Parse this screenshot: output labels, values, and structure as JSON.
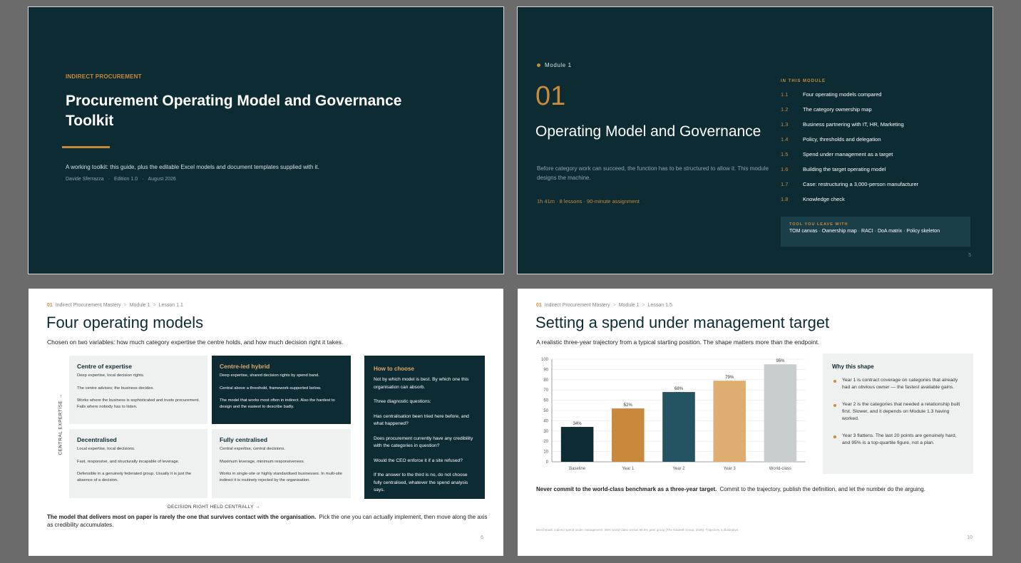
{
  "slide1": {
    "eyebrow": "INDIRECT PROCUREMENT",
    "title": "Procurement Operating Model and Governance Toolkit",
    "subtitle": "A working toolkit: this guide, plus the editable Excel models and document templates supplied with it.",
    "author": "Davide Sferrazza",
    "edition": "Edition 1.0",
    "date": "August 2026"
  },
  "slide2": {
    "module_label": "Module 1",
    "module_number": "01",
    "title": "Operating Model and Governance",
    "description": "Before category work can succeed, the function has to be structured to allow it. This module designs the machine.",
    "stats": "1h 41m · 8 lessons · 90-minute assignment",
    "in_module_label": "IN THIS MODULE",
    "lessons": [
      {
        "num": "1.1",
        "label": "Four operating models compared"
      },
      {
        "num": "1.2",
        "label": "The category ownership map"
      },
      {
        "num": "1.3",
        "label": "Business partnering with IT, HR, Marketing"
      },
      {
        "num": "1.4",
        "label": "Policy, thresholds and delegation"
      },
      {
        "num": "1.5",
        "label": "Spend under management as a target"
      },
      {
        "num": "1.6",
        "label": "Building the target operating model"
      },
      {
        "num": "1.7",
        "label": "Case: restructuring a 3,000-person manufacturer"
      },
      {
        "num": "1.8",
        "label": "Knowledge check"
      }
    ],
    "tool_label": "TOOL YOU LEAVE WITH",
    "tool_text": "TOM canvas · Ownership map · RACI · DoA matrix · Policy skeleton",
    "page": "5"
  },
  "slide3": {
    "crumb": {
      "num": "01",
      "course": "Indirect Procurement Mastery",
      "module": "Module 1",
      "lesson": "Lesson 1.1"
    },
    "title": "Four operating models",
    "lede": "Chosen on two variables: how much category expertise the centre holds, and how much decision right it takes.",
    "quadrants": [
      {
        "title": "Centre of expertise",
        "lines": [
          "Deep expertise, local decision rights.",
          "The centre advises; the business decides.",
          "Works where the business is sophisticated and trusts procurement. Fails where nobody has to listen."
        ]
      },
      {
        "title": "Centre-led hybrid",
        "lines": [
          "Deep expertise, shared decision rights by spend band.",
          "Central above a threshold, framework-supported below.",
          "The model that works most often in indirect. Also the hardest to design and the easiest to describe badly."
        ]
      },
      {
        "title": "Decentralised",
        "lines": [
          "Local expertise, local decisions.",
          "Fast, responsive, and structurally incapable of leverage.",
          "Defensible in a genuinely federated group. Usually it is just the absence of a decision."
        ]
      },
      {
        "title": "Fully centralised",
        "lines": [
          "Central expertise, central decisions.",
          "Maximum leverage, minimum responsiveness.",
          "Works in single-site or highly standardised businesses. In multi-site indirect it is routinely rejected by the organisation."
        ]
      }
    ],
    "y_axis_label": "CENTRAL EXPERTISE →",
    "x_axis_label": "DECISION RIGHT HELD CENTRALLY →",
    "choose": {
      "title": "How to choose",
      "paras": [
        "Not by which model is best. By which one this organisation can absorb.",
        "Three diagnostic questions:",
        "Has centralisation been tried here before, and what happened?",
        "Does procurement currently have any credibility with the categories in question?",
        "Would the CEO enforce it if a site refused?",
        "If the answer to the third is no, do not choose fully centralised, whatever the spend analysis says."
      ]
    },
    "bottom_bold": "The model that delivers most on paper is rarely the one that survives contact with the organisation.",
    "bottom_rest": "Pick the one you can actually implement, then move along the axis as credibility accumulates.",
    "page": "6"
  },
  "slide4": {
    "crumb": {
      "num": "01",
      "course": "Indirect Procurement Mastery",
      "module": "Module 1",
      "lesson": "Lesson 1.5"
    },
    "title": "Setting a spend under management target",
    "lede": "A realistic three-year trajectory from a typical starting position. The shape matters more than the endpoint.",
    "why_title": "Why this shape",
    "why_items": [
      "Year 1 is contract coverage on categories that already had an obvious owner — the fastest available gains.",
      "Year 2 is the categories that needed a relationship built first. Slower, and it depends on Module 1.3 having worked.",
      "Year 3 flattens. The last 20 points are genuinely hard, and 95% is a top-quartile figure, not a plan."
    ],
    "bottom_bold": "Never commit to the world-class benchmark as a three-year target.",
    "bottom_rest": "Commit to the trajectory, publish the definition, and let the number do the arguing.",
    "note": "Benchmark: indirect spend under management, 95% world-class versus 66.5% peer group (The Hackett Group, 2026). Trajectory is illustrative.",
    "page": "10"
  },
  "chart_data": {
    "type": "bar",
    "categories": [
      "Baseline",
      "Year 1",
      "Year 2",
      "Year 3",
      "World-class"
    ],
    "values": [
      34,
      52,
      68,
      79,
      95
    ],
    "data_labels": [
      "34%",
      "52%",
      "68%",
      "79%",
      "95%"
    ],
    "colors": [
      "#0d2b33",
      "#c8893d",
      "#245462",
      "#dfad6f",
      "#c8cdd0"
    ],
    "title": "",
    "xlabel": "",
    "ylabel": "",
    "ylim": [
      0,
      100
    ],
    "yticks": [
      0,
      10,
      20,
      30,
      40,
      50,
      60,
      70,
      80,
      90,
      100
    ],
    "grid": true
  }
}
